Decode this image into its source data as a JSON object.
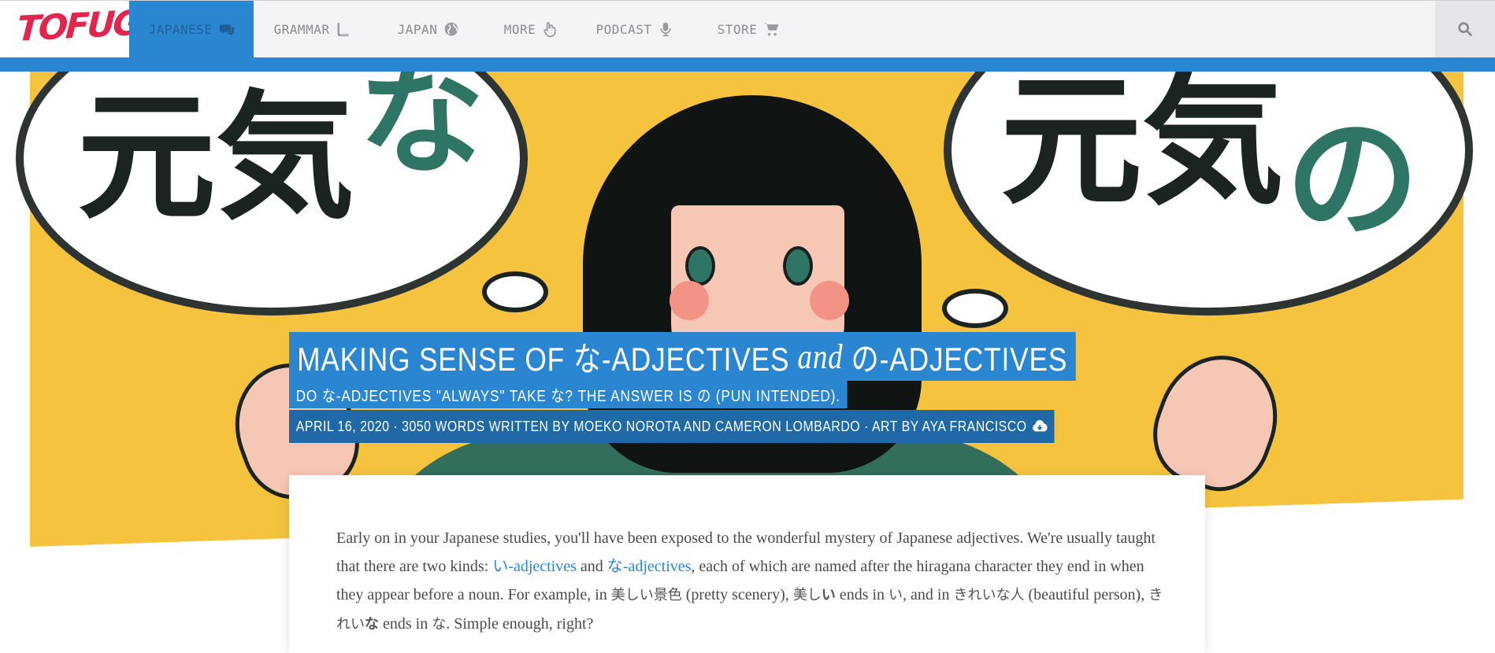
{
  "nav": {
    "logo": "TOFUGU",
    "items": [
      {
        "label": "JAPANESE",
        "icon": "comments-icon",
        "active": true
      },
      {
        "label": "GRAMMAR",
        "icon": "book-icon",
        "active": false
      },
      {
        "label": "JAPAN",
        "icon": "globe-icon",
        "active": false
      },
      {
        "label": "MORE",
        "icon": "hand-pointer-icon",
        "active": false
      },
      {
        "label": "PODCAST",
        "icon": "microphone-icon",
        "active": false
      },
      {
        "label": "STORE",
        "icon": "shopping-cart-icon",
        "active": false
      }
    ],
    "search_icon": "search-icon"
  },
  "hero": {
    "bubble_left": {
      "kanji": "元気",
      "kana": "な"
    },
    "bubble_right": {
      "kanji": "元気",
      "kana": "の"
    },
    "title_part1": "MAKING SENSE OF な-ADJECTIVES",
    "title_and": "and",
    "title_part2": "の-ADJECTIVES",
    "subtitle": "DO な-ADJECTIVES \"ALWAYS\" TAKE な? THE ANSWER IS の (PUN INTENDED).",
    "meta": "APRIL 16, 2020 · 3050 WORDS WRITTEN BY MOEKO NOROTA AND CAMERON LOMBARDO · ART BY AYA FRANCISCO",
    "meta_icon": "cloud-download-icon"
  },
  "article": {
    "s1": "Early on in your Japanese studies, you'll have been exposed to the wonderful mystery of Japanese adjectives. We're usually taught that there are two kinds: ",
    "link1": "い-adjectives",
    "s2": " and ",
    "link2": "な-adjectives",
    "s3": ", each of which are named after the hiragana character they end in when they appear before a noun. For example, in ",
    "jp1": "美しい景色",
    "s4": " (pretty scenery), ",
    "jp2a": "美し",
    "jp2b": "い",
    "s5": " ends in ",
    "jp3": "い",
    "s6": ", and in ",
    "jp4": "きれいな人",
    "s7": " (beautiful person), ",
    "jp5a": "きれい",
    "jp5b": "な",
    "s8": " ends in ",
    "jp6": "な",
    "s9": ". Simple enough, right?"
  },
  "colors": {
    "brand": "#e3254e",
    "accent": "#2a86d0",
    "hero_yellow": "#f6c33f",
    "hero_green": "#2f7566"
  }
}
